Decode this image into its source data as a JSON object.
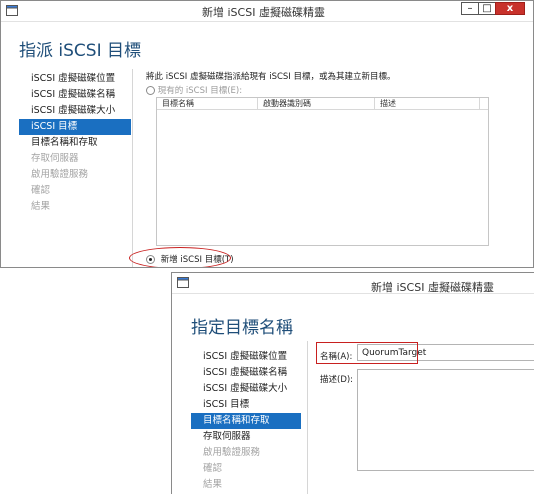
{
  "window1": {
    "title": "新增 iSCSI 虛擬磁碟精靈",
    "controls": [
      "–",
      "□",
      "x"
    ],
    "heading": "指派 iSCSI 目標",
    "nav": [
      {
        "label": "iSCSI 虛擬磁碟位置",
        "state": "normal"
      },
      {
        "label": "iSCSI 虛擬磁碟名稱",
        "state": "normal"
      },
      {
        "label": "iSCSI 虛擬磁碟大小",
        "state": "normal"
      },
      {
        "label": "iSCSI 目標",
        "state": "active"
      },
      {
        "label": "目標名稱和存取",
        "state": "normal"
      },
      {
        "label": "存取伺服器",
        "state": "disabled"
      },
      {
        "label": "啟用驗證服務",
        "state": "disabled"
      },
      {
        "label": "確認",
        "state": "disabled"
      },
      {
        "label": "結果",
        "state": "disabled"
      }
    ],
    "instruction": "將此 iSCSI 虛擬磁碟指派給現有 iSCSI 目標，或為其建立新目標。",
    "existing_option_label": "現有的 iSCSI 目標(E):",
    "table_columns": [
      "目標名稱",
      "啟動器識別碼",
      "描述"
    ],
    "new_option_label": "新增 iSCSI 目標(T)",
    "new_option_selected": true
  },
  "window2": {
    "title": "新增 iSCSI 虛擬磁碟精靈",
    "heading": "指定目標名稱",
    "nav": [
      {
        "label": "iSCSI 虛擬磁碟位置",
        "state": "normal"
      },
      {
        "label": "iSCSI 虛擬磁碟名稱",
        "state": "normal"
      },
      {
        "label": "iSCSI 虛擬磁碟大小",
        "state": "normal"
      },
      {
        "label": "iSCSI 目標",
        "state": "normal"
      },
      {
        "label": "目標名稱和存取",
        "state": "active"
      },
      {
        "label": "存取伺服器",
        "state": "normal"
      },
      {
        "label": "啟用驗證服務",
        "state": "disabled"
      },
      {
        "label": "確認",
        "state": "disabled"
      },
      {
        "label": "結果",
        "state": "disabled"
      }
    ],
    "name_label": "名稱(A):",
    "name_value": "QuorumTarget",
    "description_label": "描述(D):",
    "description_value": ""
  },
  "colors": {
    "accent": "#1a6fc1",
    "heading": "#1f4e79",
    "highlight": "#c8201f",
    "close": "#c8312b"
  }
}
